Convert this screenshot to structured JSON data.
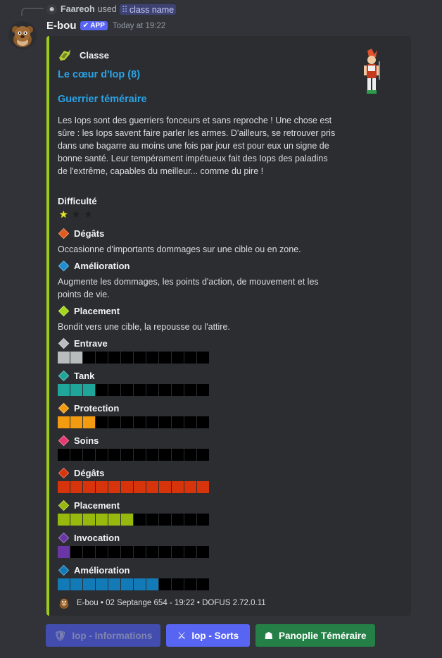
{
  "reply": {
    "user": "Faareoh",
    "used_text": "used",
    "command": "class name",
    "command_icon": "grid-icon"
  },
  "message": {
    "bot_name": "E-bou",
    "badge": "APP",
    "timestamp": "Today at 19:22"
  },
  "embed": {
    "accent_color": "#9ccc1a",
    "author": "Classe",
    "title": "Le cœur d'Iop (8)",
    "subtitle": "Guerrier téméraire",
    "description": "Les Iops sont des guerriers fonceurs et sans reproche ! Une chose est sûre : les Iops savent faire parler les armes. D'ailleurs, se retrouver pris dans une bagarre au moins une fois par jour est pour eux un signe de bonne santé. Leur tempérament impétueux fait des Iops des paladins de l'extrême, capables du meilleur... comme du pire !",
    "difficulty": {
      "label": "Difficulté",
      "value": 1,
      "max": 3
    },
    "roles": [
      {
        "label": "Dégâts",
        "color": "#e25a1c",
        "text": "Occasionne d'importants dommages sur une cible ou en zone."
      },
      {
        "label": "Amélioration",
        "color": "#1d8fd1",
        "text": "Augmente les dommages, les points d'action, de mouvement et les points de vie."
      },
      {
        "label": "Placement",
        "color": "#a6d61b",
        "text": "Bondit vers une cible, la repousse ou l'attire."
      }
    ],
    "bar_max": 12,
    "stats": [
      {
        "label": "Entrave",
        "color": "#b9bcbd",
        "value": 2
      },
      {
        "label": "Tank",
        "color": "#1fa59a",
        "value": 3
      },
      {
        "label": "Protection",
        "color": "#f29b11",
        "value": 3
      },
      {
        "label": "Soins",
        "color": "#e8386f",
        "value": 0
      },
      {
        "label": "Dégâts",
        "color": "#d8340b",
        "value": 12
      },
      {
        "label": "Placement",
        "color": "#97b90e",
        "value": 6
      },
      {
        "label": "Invocation",
        "color": "#6a36a6",
        "value": 1
      },
      {
        "label": "Amélioration",
        "color": "#137ab8",
        "value": 8
      }
    ],
    "footer": "E-bou • 02 Septange 654 - 19:22 • DOFUS 2.72.0.11"
  },
  "buttons": [
    {
      "label": "Iop - Informations",
      "icon": "iop-icon",
      "disabled": true
    },
    {
      "label": "Iop - Sorts",
      "icon": "sword-icon",
      "disabled": false
    },
    {
      "label": "Panoplie Téméraire",
      "icon": "panoply-icon",
      "disabled": false
    }
  ]
}
